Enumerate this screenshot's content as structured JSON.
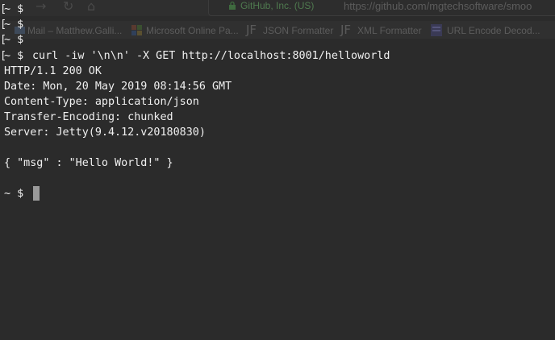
{
  "browser_ghost": {
    "site_identity": "GitHub, Inc. (US)",
    "url": "https://github.com/mgtechsoftware/smoo",
    "bookmarks": [
      {
        "label": "Mail – Matthew.Galli...",
        "icon": "mail-icon"
      },
      {
        "label": "Microsoft Online Pa...",
        "icon": "microsoft-icon"
      },
      {
        "label": "JSON Formatter",
        "icon": "jf-icon"
      },
      {
        "label": "XML Formatter",
        "icon": "jf-icon"
      },
      {
        "label": "URL Encode Decod...",
        "icon": "url-icon"
      }
    ]
  },
  "terminal": {
    "prompt_lines": [
      "~ $",
      "~ $",
      "~ $"
    ],
    "command_prompt": "~ $",
    "command": "curl -iw '\\n\\n' -X GET http://localhost:8001/helloworld",
    "response_headers": [
      "HTTP/1.1 200 OK",
      "Date: Mon, 20 May 2019 08:14:56 GMT",
      "Content-Type: application/json",
      "Transfer-Encoding: chunked",
      "Server: Jetty(9.4.12.v20180830)"
    ],
    "response_body": "{ \"msg\" : \"Hello World!\" }",
    "final_prompt": "~ $"
  },
  "colors": {
    "background": "#2b2b2b",
    "text": "#f0f0f0",
    "cursor": "#9a9a9a"
  }
}
